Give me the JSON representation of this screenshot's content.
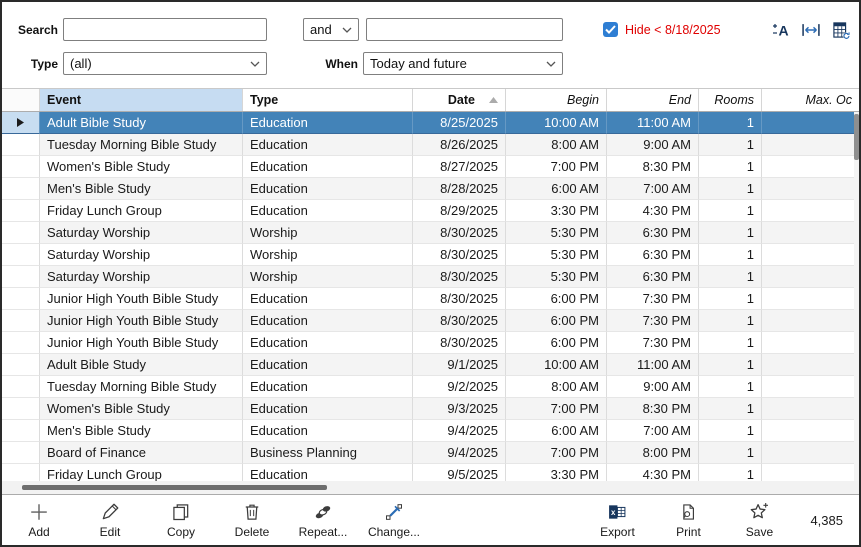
{
  "filters": {
    "search_label": "Search",
    "search_value": "",
    "operator": "and",
    "search2_value": "",
    "hide_filter": {
      "checked": true,
      "label": "Hide < 8/18/2025"
    },
    "type_label": "Type",
    "type_value": "(all)",
    "when_label": "When",
    "when_value": "Today and future",
    "icon_names": [
      "font-size-icon",
      "fit-width-icon",
      "table-options-icon"
    ]
  },
  "table": {
    "columns": [
      {
        "label": "Event",
        "align": "left",
        "style": "bold"
      },
      {
        "label": "Type",
        "align": "left",
        "style": "bold"
      },
      {
        "label": "Date",
        "align": "right",
        "style": "bold",
        "sorted": "asc"
      },
      {
        "label": "Begin",
        "align": "right",
        "style": "italic"
      },
      {
        "label": "End",
        "align": "right",
        "style": "italic"
      },
      {
        "label": "Rooms",
        "align": "right",
        "style": "italic"
      },
      {
        "label": "Max. Oc",
        "align": "right",
        "style": "italic"
      }
    ],
    "selected_row_index": 0,
    "rows": [
      {
        "event": "Adult Bible Study",
        "type": "Education",
        "date": "8/25/2025",
        "begin": "10:00 AM",
        "end": "11:00 AM",
        "rooms": "1",
        "max_occupancy": ""
      },
      {
        "event": "Tuesday Morning Bible Study",
        "type": "Education",
        "date": "8/26/2025",
        "begin": "8:00 AM",
        "end": "9:00 AM",
        "rooms": "1",
        "max_occupancy": ""
      },
      {
        "event": "Women's Bible Study",
        "type": "Education",
        "date": "8/27/2025",
        "begin": "7:00 PM",
        "end": "8:30 PM",
        "rooms": "1",
        "max_occupancy": ""
      },
      {
        "event": "Men's Bible Study",
        "type": "Education",
        "date": "8/28/2025",
        "begin": "6:00 AM",
        "end": "7:00 AM",
        "rooms": "1",
        "max_occupancy": ""
      },
      {
        "event": "Friday Lunch Group",
        "type": "Education",
        "date": "8/29/2025",
        "begin": "3:30 PM",
        "end": "4:30 PM",
        "rooms": "1",
        "max_occupancy": ""
      },
      {
        "event": "Saturday Worship",
        "type": "Worship",
        "date": "8/30/2025",
        "begin": "5:30 PM",
        "end": "6:30 PM",
        "rooms": "1",
        "max_occupancy": ""
      },
      {
        "event": "Saturday Worship",
        "type": "Worship",
        "date": "8/30/2025",
        "begin": "5:30 PM",
        "end": "6:30 PM",
        "rooms": "1",
        "max_occupancy": ""
      },
      {
        "event": "Saturday Worship",
        "type": "Worship",
        "date": "8/30/2025",
        "begin": "5:30 PM",
        "end": "6:30 PM",
        "rooms": "1",
        "max_occupancy": ""
      },
      {
        "event": "Junior High Youth Bible Study",
        "type": "Education",
        "date": "8/30/2025",
        "begin": "6:00 PM",
        "end": "7:30 PM",
        "rooms": "1",
        "max_occupancy": ""
      },
      {
        "event": "Junior High Youth Bible Study",
        "type": "Education",
        "date": "8/30/2025",
        "begin": "6:00 PM",
        "end": "7:30 PM",
        "rooms": "1",
        "max_occupancy": ""
      },
      {
        "event": "Junior High Youth Bible Study",
        "type": "Education",
        "date": "8/30/2025",
        "begin": "6:00 PM",
        "end": "7:30 PM",
        "rooms": "1",
        "max_occupancy": ""
      },
      {
        "event": "Adult Bible Study",
        "type": "Education",
        "date": "9/1/2025",
        "begin": "10:00 AM",
        "end": "11:00 AM",
        "rooms": "1",
        "max_occupancy": ""
      },
      {
        "event": "Tuesday Morning Bible Study",
        "type": "Education",
        "date": "9/2/2025",
        "begin": "8:00 AM",
        "end": "9:00 AM",
        "rooms": "1",
        "max_occupancy": ""
      },
      {
        "event": "Women's Bible Study",
        "type": "Education",
        "date": "9/3/2025",
        "begin": "7:00 PM",
        "end": "8:30 PM",
        "rooms": "1",
        "max_occupancy": ""
      },
      {
        "event": "Men's Bible Study",
        "type": "Education",
        "date": "9/4/2025",
        "begin": "6:00 AM",
        "end": "7:00 AM",
        "rooms": "1",
        "max_occupancy": ""
      },
      {
        "event": "Board of Finance",
        "type": "Business Planning",
        "date": "9/4/2025",
        "begin": "7:00 PM",
        "end": "8:00 PM",
        "rooms": "1",
        "max_occupancy": ""
      },
      {
        "event": "Friday Lunch Group",
        "type": "Education",
        "date": "9/5/2025",
        "begin": "3:30 PM",
        "end": "4:30 PM",
        "rooms": "1",
        "max_occupancy": ""
      }
    ]
  },
  "toolbar": {
    "left_buttons": [
      {
        "label": "Add",
        "icon": "plus-icon"
      },
      {
        "label": "Edit",
        "icon": "pencil-icon"
      },
      {
        "label": "Copy",
        "icon": "copy-icon"
      },
      {
        "label": "Delete",
        "icon": "trash-icon"
      },
      {
        "label": "Repeat...",
        "icon": "repeat-icon"
      },
      {
        "label": "Change...",
        "icon": "change-icon"
      }
    ],
    "right_buttons": [
      {
        "label": "Export",
        "icon": "excel-icon"
      },
      {
        "label": "Print",
        "icon": "print-icon"
      },
      {
        "label": "Save",
        "icon": "save-star-icon"
      }
    ],
    "record_count": "4,385"
  },
  "colors": {
    "selection_blue": "#4383b8",
    "selected_column_header": "#c6dcf2",
    "checkbox_blue": "#2e7ed3",
    "filter_red": "#e00000",
    "icon_navy": "#17365d",
    "icon_blue": "#2b6cb5"
  }
}
